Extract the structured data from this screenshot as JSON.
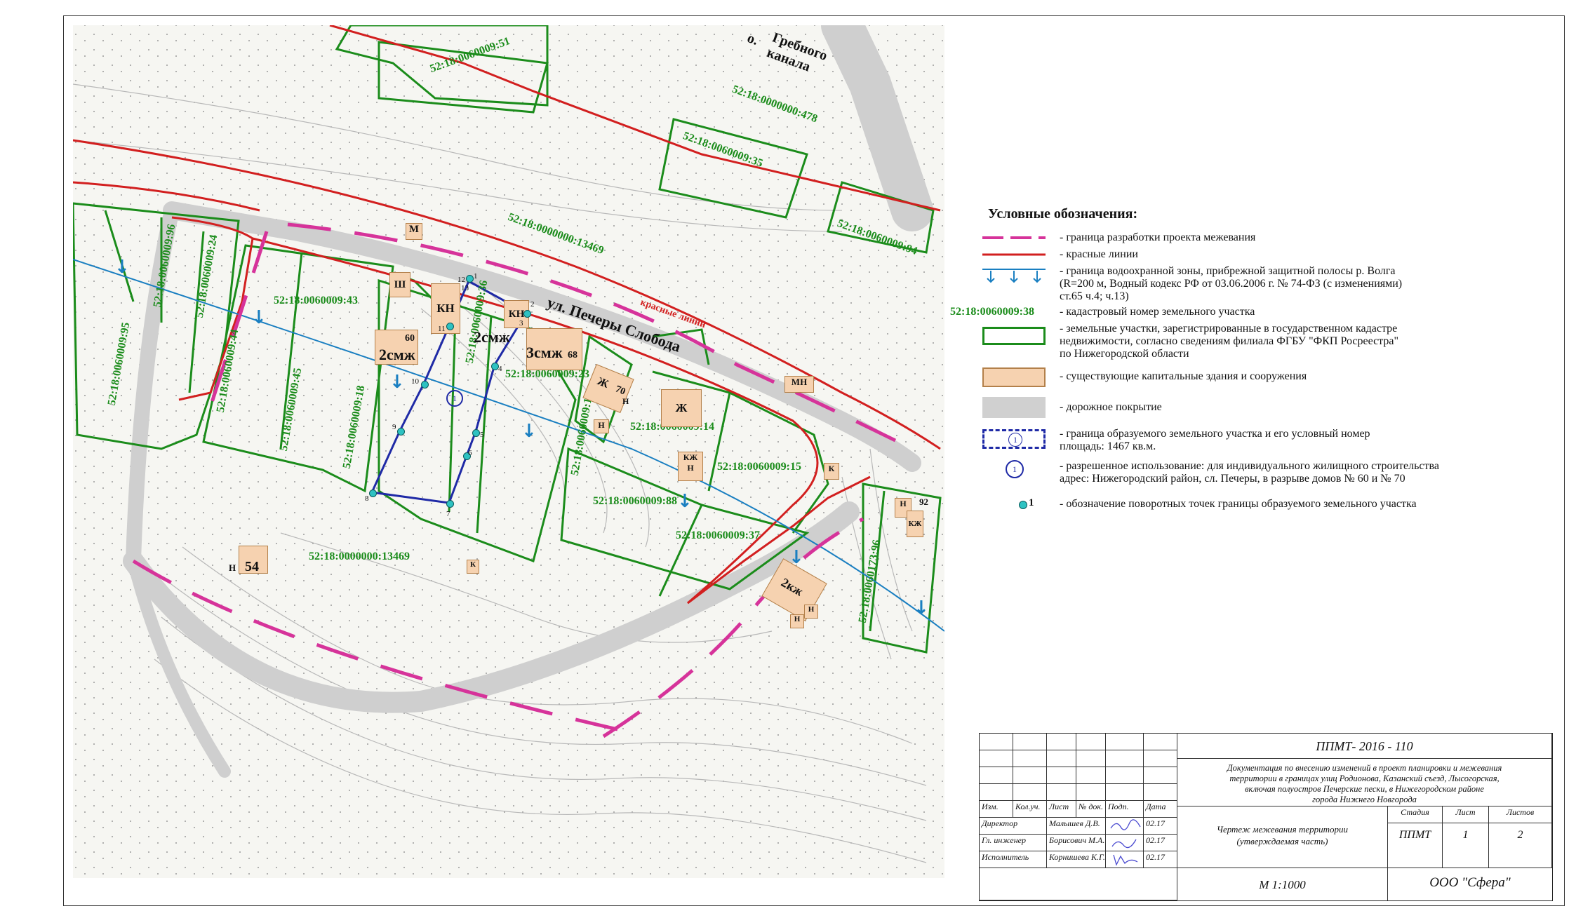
{
  "map": {
    "street_label": "ул. Печеры Слобода",
    "canal_label": "Гребного канала",
    "canal_label_prefix": "о.",
    "red_line_label": "красные линии",
    "water_arrow_glyph": "↓",
    "parcel_label": "1",
    "cadastral": {
      "c51": "52:18:0060009:51",
      "c478": "52:18:0000000:478",
      "c35": "52:18:0060009:35",
      "c94": "52:18:0060009:94",
      "c13469a": "52:18:0000000:13469",
      "c13469b": "52:18:0000000:13469",
      "c96": "52:18:0060009:96",
      "c24": "52:18:0060009:24",
      "c43": "52:18:0060009:43",
      "c95": "52:18:0060009:95",
      "c44": "52:18:0060009:44",
      "c45": "52:18:0060009:45",
      "c18": "52:18:0060009:18",
      "c36": "52:18:0060009:36",
      "c23": "52:18:0060009:23",
      "c17": "52:18:0060009:17",
      "c14": "52:18:0060009:14",
      "c15": "52:18:0060009:15",
      "c88": "52:18:0060009:88",
      "c37": "52:18:0060009:37",
      "c96b": "52:18:0060173:96"
    },
    "buildings": {
      "m": "М",
      "sh": "Ш",
      "kn1": "КН",
      "kn2": "КН",
      "n60": "60",
      "b2smzh1": "2смж",
      "b2smzh2": "2смж",
      "b3smzh": "3смж",
      "n68": "68",
      "zh70": "Ж",
      "n70": "70",
      "n_a": "Н",
      "n_b": "Н",
      "zh": "Ж",
      "kzh": "КЖ",
      "n_c": "Н",
      "k1": "К",
      "mn": "МН",
      "n54": "54",
      "n_d": "Н",
      "k2": "К",
      "n_e": "Н",
      "n92": "92",
      "kzh2": "КЖ",
      "b2kzh": "2кж",
      "n_f": "Н",
      "n_g": "Н"
    },
    "points": [
      "1",
      "2",
      "3",
      "4",
      "5",
      "6",
      "7",
      "8",
      "9",
      "10",
      "11",
      "12",
      "13"
    ]
  },
  "legend": {
    "title": "Условные обозначения:",
    "items": [
      {
        "text": "- граница разработки проекта межевания"
      },
      {
        "text": "- красные линии"
      },
      {
        "text": "- граница водоохранной зоны, прибрежной защитной полосы р. Волга\n(R=200 м, Водный кодекс РФ от 03.06.2006 г. № 74-ФЗ (с изменениями)\nст.65 ч.4; ч.13)"
      },
      {
        "text": "- кадастровый номер земельного участка"
      },
      {
        "text": "- земельные участки, зарегистрированные в государственном кадастре\nнедвижимости, согласно сведениям филиала ФГБУ \"ФКП Росреестра\"\nпо Нижегородской области"
      },
      {
        "text": "- существующие капитальные здания и сооружения"
      },
      {
        "text": "- дорожное покрытие"
      },
      {
        "text": "- граница образуемого земельного участка и его условный номер\nплощадь: 1467 кв.м."
      },
      {
        "text": "- разрешенное использование: для индивидуального жилищного строительства\nадрес: Нижегородский район, сл. Печеры, в разрыве домов № 60 и № 70"
      },
      {
        "text": "- обозначение поворотных точек границы образуемого земельного участка"
      }
    ],
    "sample_cadastral": "52:18:0060009:38",
    "sample_parcel_num": "1",
    "sample_point_num": "1"
  },
  "stamp": {
    "code": "ППМТ- 2016 - 110",
    "description": "Документация по внесению изменений в проект планировки и межевания\nтерритории в границах улиц Родионова, Казанский съезд, Лысогорская,\nвключая полуостров Печерские пески, в Нижегородском районе\nгорода Нижнего Новгорода",
    "header": {
      "izm": "Изм.",
      "koluch": "Кол.уч.",
      "list": "Лист",
      "ndok": "№ док.",
      "podp": "Подп.",
      "data": "Дата"
    },
    "rows": [
      {
        "role": "Директор",
        "name": "Малышев Д.В.",
        "date": "02.17"
      },
      {
        "role": "Гл. инженер",
        "name": "Борисович М.А.",
        "date": "02.17"
      },
      {
        "role": "Исполнитель",
        "name": "Корнишева К.Г.",
        "date": "02.17"
      }
    ],
    "drawing_title": "Чертеж межевания территории\n(утверждаемая часть)",
    "stage_label": "Стадия",
    "sheet_label": "Лист",
    "sheets_label": "Листов",
    "stage": "ППМТ",
    "sheet": "1",
    "sheets": "2",
    "scale": "М 1:1000",
    "company": "ООО \"Сфера\""
  }
}
